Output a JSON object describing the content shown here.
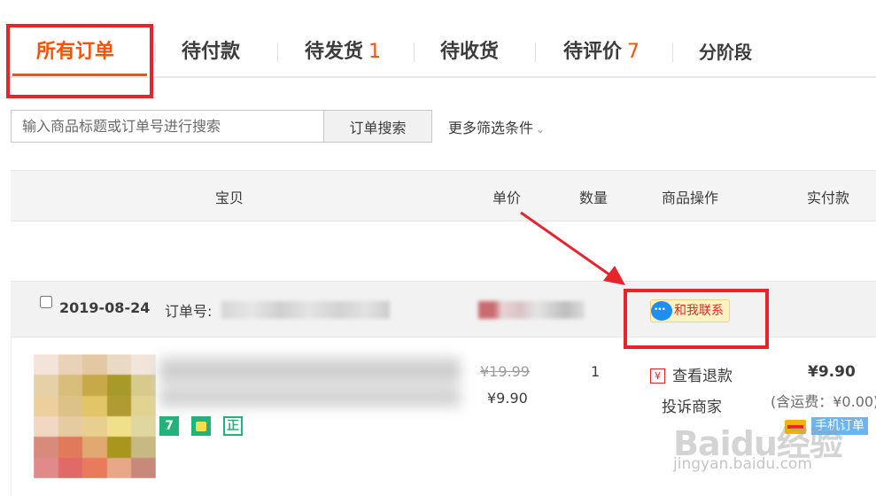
{
  "tabs": [
    {
      "label": "所有订单",
      "count": ""
    },
    {
      "label": "待付款",
      "count": ""
    },
    {
      "label": "待发货",
      "count": "1"
    },
    {
      "label": "待收货",
      "count": ""
    },
    {
      "label": "待评价",
      "count": "7"
    },
    {
      "label": "分阶段",
      "count": ""
    }
  ],
  "search": {
    "placeholder": "输入商品标题或订单号进行搜索",
    "button_label": "订单搜索",
    "more_filters_label": "更多筛选条件"
  },
  "table_header": {
    "item": "宝贝",
    "unit_price": "单价",
    "quantity": "数量",
    "item_actions": "商品操作",
    "paid": "实付款"
  },
  "order": {
    "date": "2019-08-24",
    "order_no_label": "订单号:",
    "contact_label": "和我联系",
    "service_icons": [
      "7",
      "bag-icon",
      "正"
    ],
    "original_price": "¥19.99",
    "price": "¥9.90",
    "quantity": "1",
    "refund_label": "查看退款",
    "complain_label": "投诉商家",
    "paid_amount": "¥9.90",
    "shipping_note": "(含运费：¥0.00)",
    "mobile_order_label": "手机订单"
  },
  "colors": {
    "accent": "#ff5000",
    "annotation_red": "#e8242b",
    "service_green": "#22b37a",
    "mobile_tag_blue": "#6fb4ec"
  },
  "watermark": {
    "logo": "Baidu经验",
    "url": "jingyan.baidu.com"
  }
}
